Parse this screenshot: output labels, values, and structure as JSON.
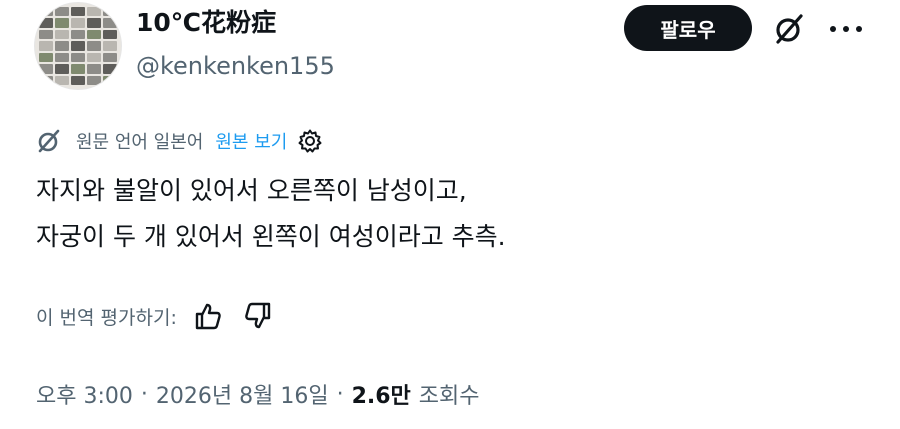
{
  "header": {
    "display_name": "10℃花粉症",
    "handle": "@kenkenken155",
    "follow_label": "팔로우"
  },
  "translation": {
    "note": "원문 언어 일본어",
    "show_original": "원본 보기"
  },
  "tweet": {
    "lines": [
      "자지와 불알이 있어서 오른쪽이 남성이고,",
      "자궁이 두 개 있어서 왼쪽이 여성이라고 추측."
    ]
  },
  "rating": {
    "label": "이 번역 평가하기:"
  },
  "meta": {
    "time": "오후 3:00",
    "separator": "·",
    "date": "2026년 8월 16일",
    "views_count": "2.6만",
    "views_label": "조회수"
  },
  "colors": {
    "text": "#0f1419",
    "secondary": "#536471",
    "link": "#1d9bf0",
    "button_bg": "#0f1419"
  }
}
